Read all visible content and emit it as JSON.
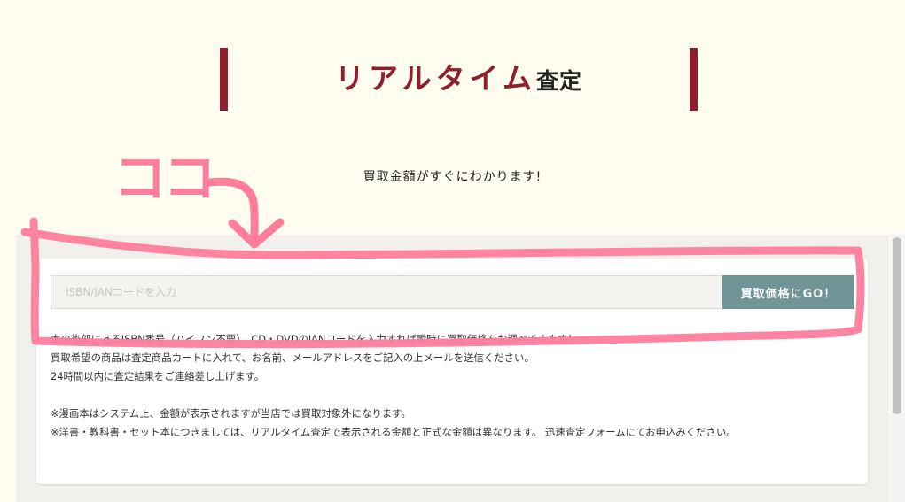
{
  "header": {
    "title_main": "リアルタイム",
    "title_suffix": "査定",
    "subtitle": "買取金額がすぐにわかります!"
  },
  "search": {
    "placeholder": "ISBN/JANコードを入力",
    "value": "",
    "button_label": "買取価格にGO！"
  },
  "info": {
    "lines": [
      "本の後部にあるISBN番号（ハイフン不要）、CD・DVDのJANコードを入力すれば瞬時に買取価格をお調べできます！",
      "買取希望の商品は査定商品カートに入れて、お名前、メールアドレスをご記入の上メールを送信ください。",
      "24時間以内に査定結果をご連絡差し上げます。"
    ],
    "notes": [
      "※漫画本はシステム上、金額が表示されますが当店では買取対象外になります。",
      "※洋書・教科書・セット本につきましては、リアルタイム査定で表示される金額と正式な金額は異なります。 迅速査定フォームにてお申込みください。"
    ]
  },
  "annotation": {
    "label": "ココ",
    "color": "#ff7d9c"
  },
  "colors": {
    "brand_red": "#8e1f2b",
    "button_teal": "#6f9596",
    "page_background": "#fffdf0",
    "panel_gray": "#f1f0ec"
  }
}
